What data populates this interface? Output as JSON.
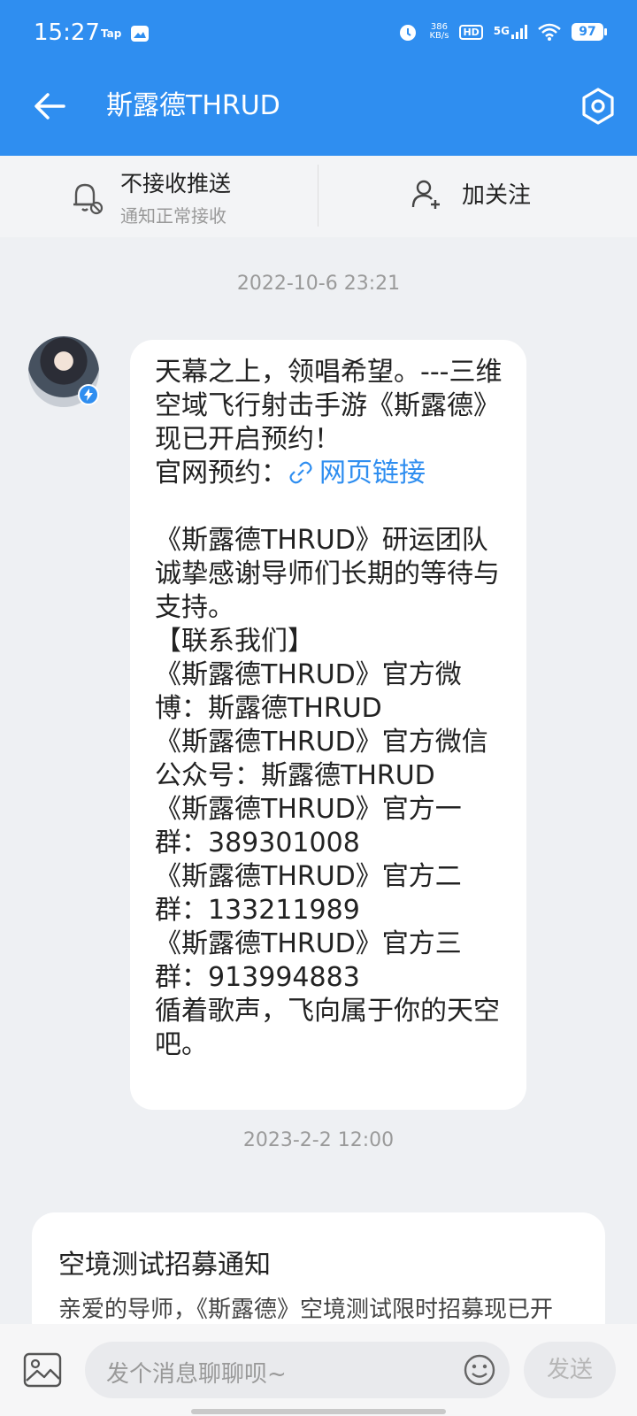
{
  "status_bar": {
    "time": "15:27",
    "app_badge": "Tap",
    "net_speed_value": "386",
    "net_speed_unit": "KB/s",
    "hd_label": "HD",
    "network": "5G",
    "battery": "97"
  },
  "header": {
    "title": "斯露德THRUD"
  },
  "actions": {
    "push_label": "不接收推送",
    "push_sub": "通知正常接收",
    "follow_label": "加关注"
  },
  "messages": {
    "time1": "2022-10-6 23:21",
    "text_intro": "天幕之上，领唱希望。---三维空域飞行射击手游《斯露德》现已开启预约！\n官网预约：",
    "link_label": "网页链接",
    "text_body": "\n\n《斯露德THRUD》研运团队诚挚感谢导师们长期的等待与支持。\n【联系我们】\n《斯露德THRUD》官方微博：斯露德THRUD\n《斯露德THRUD》官方微信公众号：斯露德THRUD\n《斯露德THRUD》官方一群：389301008\n《斯露德THRUD》官方二群：133211989\n《斯露德THRUD》官方三群：913994883\n循着歌声，飞向属于你的天空吧。",
    "time2": "2023-2-2 12:00",
    "card_title": "空境测试招募通知",
    "card_body": "亲爱的导师，《斯露德》空境测试限时招募现已开启！"
  },
  "input_bar": {
    "placeholder": "发个消息聊聊呗~",
    "send_label": "发送"
  },
  "colors": {
    "accent": "#2f8ef0",
    "background": "#eef0f3"
  }
}
